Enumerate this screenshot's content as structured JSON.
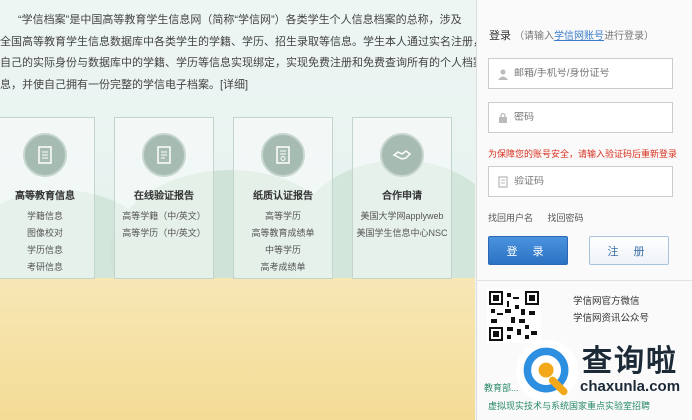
{
  "intro": {
    "lines": [
      "“学信档案”是中国高等教育学生信息网（简称“学信网”）各类学生个人信息档案的总称，涉及",
      "全国高等教育学生信息数据库中各类学生的学籍、学历、招生录取等信息。学生本人通过实名注册，将",
      "自己的实际身份与数据库中的学籍、学历等信息实现绑定，实现免费注册和免费查询所有的个人档案信",
      "息，并使自己拥有一份完整的学信电子档案。[详细]"
    ]
  },
  "cards": [
    {
      "icon": "document-icon",
      "title": "高等教育信息",
      "items": [
        "学籍信息",
        "图像校对",
        "学历信息",
        "考研信息"
      ]
    },
    {
      "icon": "report-icon",
      "title": "在线验证报告",
      "items": [
        "高等学籍（中/英文）",
        "高等学历（中/英文）"
      ]
    },
    {
      "icon": "certificate-icon",
      "title": "纸质认证报告",
      "items": [
        "高等学历",
        "高等教育成绩单",
        "中等学历",
        "高考成绩单"
      ]
    },
    {
      "icon": "handshake-icon",
      "title": "合作申请",
      "items": [
        "美国大学网applyweb",
        "美国学生信息中心NSC"
      ]
    }
  ],
  "login": {
    "title": "登录",
    "hint_prefix": "（请输入",
    "hint_link": "学信网账号",
    "hint_suffix": "进行登录）",
    "username_placeholder": "邮箱/手机号/身份证号",
    "password_placeholder": "密码",
    "warning": "为保障您的账号安全，请输入验证码后重新登录",
    "captcha_placeholder": "验证码",
    "find_username": "找回用户名",
    "find_password": "找回密码",
    "login_button": "登 录",
    "register_button": "注 册"
  },
  "qr": {
    "line1": "学信网官方微信",
    "line2": "学信网资讯公众号",
    "caption": "教育部...",
    "sub": "虚拟现实技术与系统国家重点实验室招聘"
  },
  "watermark": {
    "cn": "查询啦",
    "en": "chaxunla.com"
  },
  "colors": {
    "accent_blue": "#2c72c4",
    "warning_red": "#d9301f",
    "link_green": "#2a8a6b",
    "icon_circle": "#a6bbb1"
  }
}
